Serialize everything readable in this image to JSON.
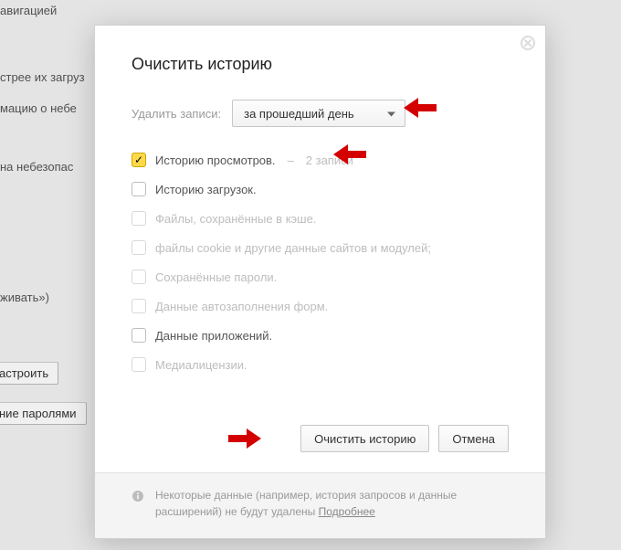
{
  "background": {
    "frag_nav": "авигацией",
    "frag_load": "стрее их загруз",
    "frag_info": "мацию о небе",
    "frag_unsafe": "на небезопас",
    "frag_show": "живать»)",
    "btn_configure": "астроить",
    "btn_passwords": "ние паролями"
  },
  "modal": {
    "title": "Очистить историю",
    "select_label": "Удалить записи:",
    "select_value": "за прошедший день",
    "options": [
      {
        "label": "Историю просмотров.",
        "count": "2 записи",
        "checked": true,
        "enabled": true
      },
      {
        "label": "Историю загрузок.",
        "checked": false,
        "enabled": true
      },
      {
        "label": "Файлы, сохранённые в кэше.",
        "checked": false,
        "enabled": false
      },
      {
        "label": "файлы cookie и другие данные сайтов и модулей;",
        "checked": false,
        "enabled": false
      },
      {
        "label": "Сохранённые пароли.",
        "checked": false,
        "enabled": false
      },
      {
        "label": "Данные автозаполнения форм.",
        "checked": false,
        "enabled": false
      },
      {
        "label": "Данные приложений.",
        "checked": false,
        "enabled": true
      },
      {
        "label": "Медиалицензии.",
        "checked": false,
        "enabled": false
      }
    ],
    "separator": "–",
    "clear_btn": "Очистить историю",
    "cancel_btn": "Отмена",
    "footer_text": "Некоторые данные (например, история запросов и данные расширений) не будут удалены ",
    "footer_link": "Подробнее"
  }
}
